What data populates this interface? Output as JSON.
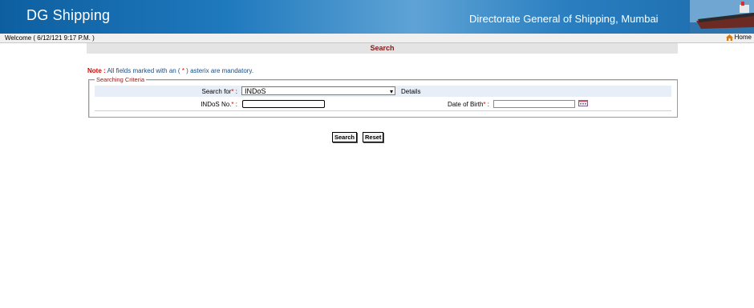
{
  "header": {
    "brand": "DG Shipping",
    "department": "Directorate General of Shipping, Mumbai"
  },
  "welcome_bar": {
    "welcome_text": "Welcome ( 6/12/121 9:17 P.M. )",
    "home_label": "Home"
  },
  "page": {
    "title": "Search"
  },
  "note": {
    "prefix": "Note :",
    "text_before": " All fields marked with an ( ",
    "asterisk": "*",
    "text_after": " ) asterix are mandatory."
  },
  "form": {
    "legend": "Searching Criteria",
    "search_for_label": "Search for",
    "search_for_value": "INDoS",
    "details_label": "Details",
    "indos_label": "INDoS No.",
    "indos_value": "",
    "dob_label": "Date of Birth",
    "dob_value": "",
    "mandatory_mark": "*",
    "colon": " :"
  },
  "buttons": {
    "search": "Search",
    "reset": "Reset"
  },
  "colors": {
    "brand_blue": "#1a6aaa",
    "title_text": "#7a1a1a",
    "mandatory": "#dd0000"
  }
}
